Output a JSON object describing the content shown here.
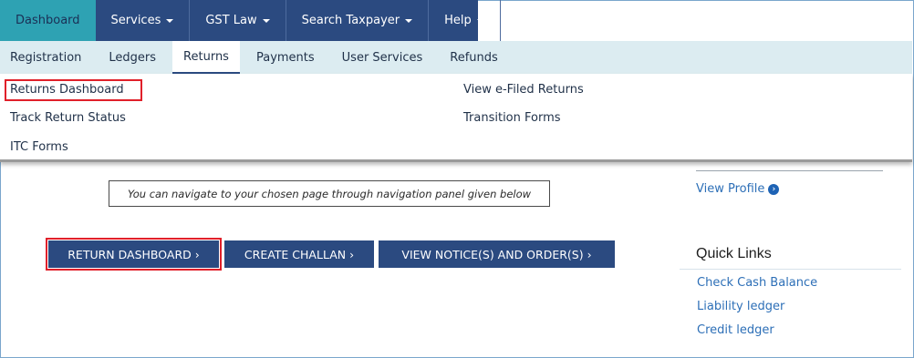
{
  "topnav": {
    "items": [
      {
        "label": "Dashboard",
        "active": true,
        "dropdown": false
      },
      {
        "label": "Services",
        "active": false,
        "dropdown": true
      },
      {
        "label": "GST Law",
        "active": false,
        "dropdown": true
      },
      {
        "label": "Search Taxpayer",
        "active": false,
        "dropdown": true
      },
      {
        "label": "Help",
        "active": false,
        "dropdown": true
      }
    ]
  },
  "subnav": {
    "items": [
      "Registration",
      "Ledgers",
      "Returns",
      "Payments",
      "User Services",
      "Refunds"
    ],
    "active": "Returns"
  },
  "dropdown": {
    "left": [
      "Returns Dashboard",
      "Track Return Status",
      "ITC Forms"
    ],
    "right": [
      "View e-Filed Returns",
      "Transition Forms"
    ],
    "highlighted": "Returns Dashboard"
  },
  "main": {
    "message": "You can navigate to your chosen page through navigation panel given below",
    "buttons": [
      "RETURN DASHBOARD ›",
      "CREATE CHALLAN ›",
      "VIEW NOTICE(S) AND ORDER(S) ›"
    ]
  },
  "sidebar": {
    "view_profile": "View Profile",
    "quick_links_title": "Quick Links",
    "quick_links": [
      "Check Cash Balance",
      "Liability ledger",
      "Credit ledger"
    ]
  },
  "colors": {
    "nav_bg": "#2b4a80",
    "nav_active": "#2ea2b3",
    "subnav_bg": "#dcecf1",
    "highlight": "#e0202a",
    "link": "#2d6fb7"
  },
  "icons": {
    "caret": "chevron-down-icon",
    "view_profile_arrow": "circle-arrow-right-icon"
  }
}
